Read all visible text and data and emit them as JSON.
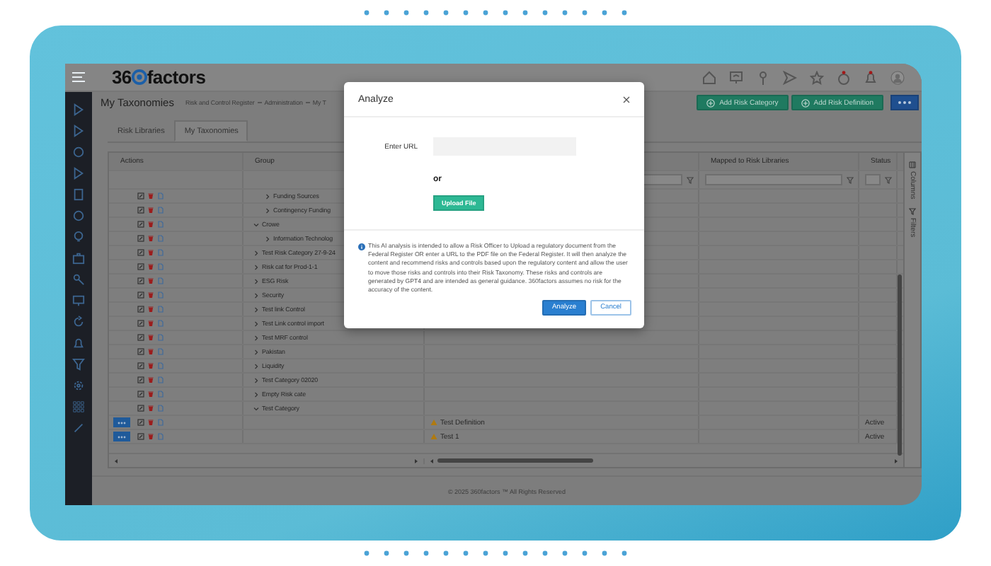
{
  "topbar": {
    "logo": {
      "lead": "36",
      "tail": "factors"
    }
  },
  "page": {
    "title": "My Taxonomies",
    "breadcrumb": [
      "Risk and Control Register",
      "Administration",
      "My T"
    ],
    "actions": [
      {
        "label": "Add Risk Category"
      },
      {
        "label": "Add Risk Definition"
      }
    ]
  },
  "tabs": [
    {
      "label": "Risk Libraries",
      "selected": false
    },
    {
      "label": "My Taxonomies",
      "selected": true
    }
  ],
  "grid": {
    "columns": {
      "actions": "Actions",
      "group": "Group",
      "mapped": "Mapped to Risk Libraries",
      "status": "Status"
    },
    "side_panel": [
      "Columns",
      "Filters"
    ],
    "rows": [
      {
        "children": [
          {
            "kind": "category",
            "group": "Funding Sources",
            "expanded": false
          },
          {
            "kind": "category",
            "group": "Contingency Funding",
            "expanded": false
          }
        ]
      },
      {
        "kind": "category",
        "group": "Crowe",
        "expanded": true,
        "children": [
          {
            "kind": "category",
            "group": "Information Technolog",
            "expanded": false
          }
        ]
      },
      {
        "kind": "category",
        "group": "Test Risk Category 27-9-24",
        "expanded": false
      },
      {
        "kind": "category",
        "group": "Risk cat for Prod-1-1",
        "expanded": false
      },
      {
        "kind": "category",
        "group": "ESG Risk",
        "expanded": false
      },
      {
        "kind": "category",
        "group": "Security",
        "expanded": false
      },
      {
        "kind": "category",
        "group": "Test link Control",
        "expanded": false
      },
      {
        "kind": "category",
        "group": "Test Link control import",
        "expanded": false
      },
      {
        "kind": "category",
        "group": "Test MRF control",
        "expanded": false
      },
      {
        "kind": "category",
        "group": "Pakistan",
        "expanded": false
      },
      {
        "kind": "category",
        "group": "Liquidity",
        "expanded": false
      },
      {
        "kind": "category",
        "group": "Test Category 02020",
        "expanded": false
      },
      {
        "kind": "category",
        "group": "Empty Risk cate",
        "expanded": false
      },
      {
        "kind": "category",
        "group": "Test Category",
        "expanded": true,
        "children": [
          {
            "kind": "definition",
            "name": "Test Definition",
            "status": "Active"
          },
          {
            "kind": "definition",
            "name": "Test 1",
            "status": "Active"
          }
        ]
      }
    ]
  },
  "footer": "© 2025 360factors ™ All Rights Reserved",
  "modal": {
    "title": "Analyze",
    "url_label": "Enter URL",
    "or": "or",
    "upload": "Upload File",
    "note": "This AI analysis is intended to allow a Risk Officer to Upload a regulatory document from the Federal Register OR enter a URL to the PDF file on the Federal Register. It will then analyze the content and recommend risks and controls based upon the regulatory content and allow the user to move those risks and controls into their Risk Taxonomy. These risks and controls are generated by GPT4 and are intended as general guidance. 360factors assumes no risk for the accuracy of the content.",
    "buttons": [
      {
        "label": "Analyze",
        "kind": "primary"
      },
      {
        "label": "Cancel",
        "kind": "secondary"
      }
    ]
  }
}
